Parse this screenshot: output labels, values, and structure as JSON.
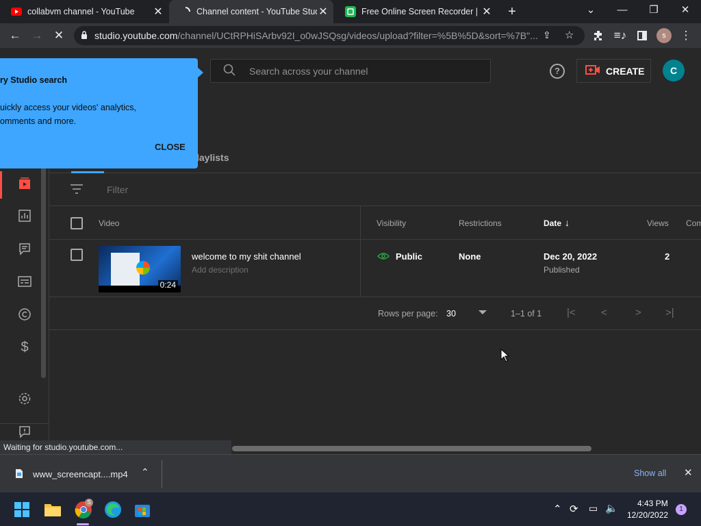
{
  "browser": {
    "tabs": [
      {
        "title": "collabvm channel - YouTube",
        "favicon": "youtube-icon"
      },
      {
        "title": "Channel content - YouTube Studio",
        "favicon": "loading-icon"
      },
      {
        "title": "Free Online Screen Recorder | Online",
        "favicon": "recorder-icon"
      }
    ],
    "url_host": "studio.youtube.com",
    "url_path": "/channel/UCtRPHiSArbv92I_o0wJSQsg/videos/upload?filter=%5B%5D&sort=%7B\"..."
  },
  "studio": {
    "search_placeholder": "Search across your channel",
    "create_label": "CREATE",
    "avatar_letter": "C",
    "tooltip": {
      "title": "ry Studio search",
      "line1": "uickly access your videos' analytics,",
      "line2": "omments and more.",
      "close": "CLOSE"
    },
    "tab_partial": "laylists",
    "filter_placeholder": "Filter",
    "columns": {
      "video": "Video",
      "visibility": "Visibility",
      "restrictions": "Restrictions",
      "date": "Date",
      "views": "Views",
      "comments": "Com"
    },
    "row": {
      "title": "welcome to my shit channel",
      "description": "Add description",
      "duration": "0:24",
      "visibility": "Public",
      "restrictions": "None",
      "date": "Dec 20, 2022",
      "date_status": "Published",
      "views": "2"
    },
    "pager": {
      "rows_label": "Rows per page:",
      "rows_value": "30",
      "range": "1–1 of 1"
    }
  },
  "status_text": "Waiting for studio.youtube.com...",
  "download": {
    "file": "www_screencapt....mp4",
    "show_all": "Show all"
  },
  "taskbar": {
    "time": "4:43 PM",
    "date": "12/20/2022",
    "notification_count": "1",
    "chrome_profile": "S"
  }
}
